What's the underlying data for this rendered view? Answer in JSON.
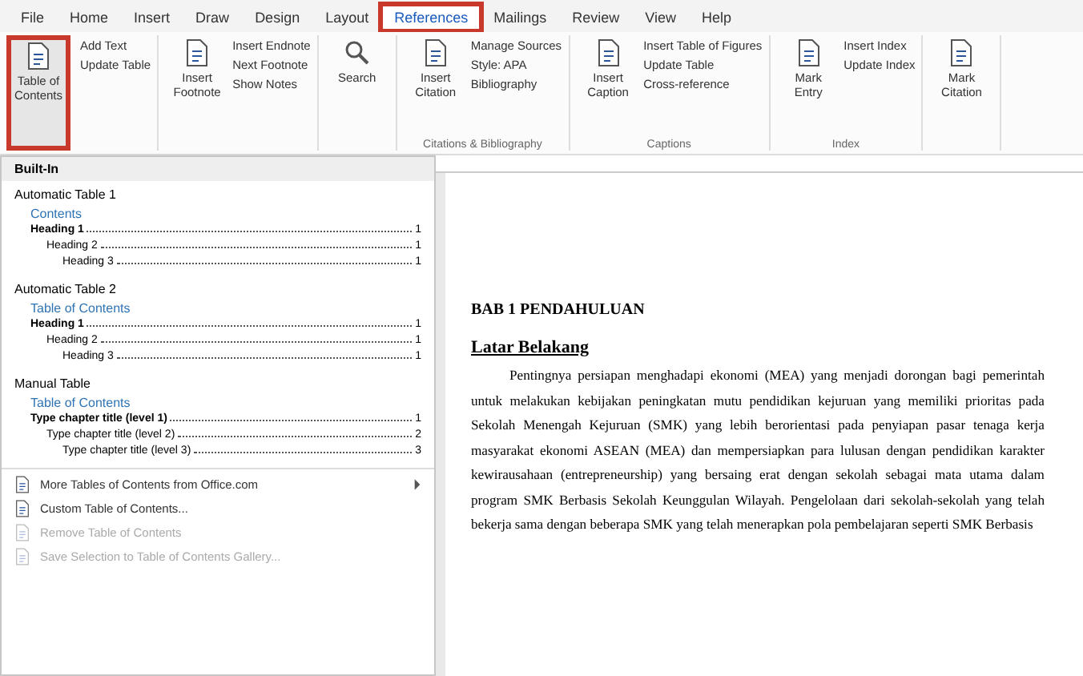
{
  "tabs": [
    {
      "label": "File",
      "selected": false
    },
    {
      "label": "Home",
      "selected": false
    },
    {
      "label": "Insert",
      "selected": false
    },
    {
      "label": "Draw",
      "selected": false
    },
    {
      "label": "Design",
      "selected": false
    },
    {
      "label": "Layout",
      "selected": false
    },
    {
      "label": "References",
      "selected": true
    },
    {
      "label": "Mailings",
      "selected": false
    },
    {
      "label": "Review",
      "selected": false
    },
    {
      "label": "View",
      "selected": false
    },
    {
      "label": "Help",
      "selected": false
    }
  ],
  "ribbon": {
    "toc_button": "Table of Contents",
    "toc_items": [
      "Add Text",
      "Update Table"
    ],
    "footnotes": {
      "big": "Insert Footnote",
      "items": [
        "Insert Endnote",
        "Next Footnote",
        "Show Notes"
      ]
    },
    "search": "Search",
    "citations": {
      "big": "Insert Citation",
      "items": [
        "Manage Sources",
        "Style: APA",
        "Bibliography"
      ],
      "group": "Citations & Bibliography"
    },
    "captions": {
      "big": "Insert Caption",
      "items": [
        "Insert Table of Figures",
        "Update Table",
        "Cross-reference"
      ],
      "group": "Captions"
    },
    "index": {
      "big": "Mark Entry",
      "items": [
        "Insert Index",
        "Update Index"
      ],
      "group": "Index"
    },
    "authorities": {
      "big": "Mark Citation"
    }
  },
  "menu": {
    "sections": [
      {
        "header": "Built-In",
        "kind": "header"
      },
      {
        "kind": "toc",
        "name": "Automatic Table 1",
        "title": "Contents",
        "entries": [
          {
            "text": "Heading 1",
            "page": "1",
            "children": [
              {
                "text": "Heading 2",
                "page": "1",
                "children": [
                  {
                    "text": "Heading 3",
                    "page": "1"
                  }
                ]
              }
            ]
          }
        ]
      },
      {
        "kind": "toc",
        "name": "Automatic Table 2",
        "title": "Table of Contents",
        "entries": [
          {
            "text": "Heading 1",
            "page": "1",
            "children": [
              {
                "text": "Heading 2",
                "page": "1",
                "children": [
                  {
                    "text": "Heading 3",
                    "page": "1"
                  }
                ]
              }
            ]
          }
        ]
      },
      {
        "kind": "toc",
        "name": "Manual Table",
        "title": "Table of Contents",
        "entries": [
          {
            "text": "Type chapter title (level 1)",
            "page": "1",
            "children": [
              {
                "text": "Type chapter title (level 2)",
                "page": "2",
                "children": [
                  {
                    "text": "Type chapter title (level 3)",
                    "page": "3"
                  }
                ]
              }
            ]
          }
        ]
      }
    ],
    "commands": [
      {
        "label": "More Tables of Contents from Office.com",
        "disabled": false,
        "submenu": true
      },
      {
        "label": "Custom Table of Contents...",
        "disabled": false,
        "submenu": false
      },
      {
        "label": "Remove Table of Contents",
        "disabled": true,
        "submenu": false
      },
      {
        "label": "Save Selection to Table of Contents Gallery...",
        "disabled": true,
        "submenu": false
      }
    ]
  },
  "document": {
    "chapter": "BAB 1 PENDAHULUAN",
    "heading": "Latar Belakang",
    "paragraph": "Pentingnya persiapan menghadapi ekonomi (MEA) yang menjadi dorongan bagi pemerintah untuk melakukan kebijakan peningkatan mutu pendidikan kejuruan yang memiliki prioritas pada Sekolah Menengah Kejuruan (SMK) yang lebih berorientasi pada penyiapan pasar tenaga kerja masyarakat ekonomi ASEAN (MEA) dan mempersiapkan para lulusan dengan pendidikan karakter kewirausahaan (entrepreneurship) yang bersaing erat dengan sekolah sebagai mata utama dalam program SMK Berbasis Sekolah Keunggulan Wilayah. Pengelolaan dari sekolah-sekolah yang telah bekerja sama dengan beberapa SMK yang telah menerapkan pola pembelajaran seperti SMK Berbasis"
  }
}
